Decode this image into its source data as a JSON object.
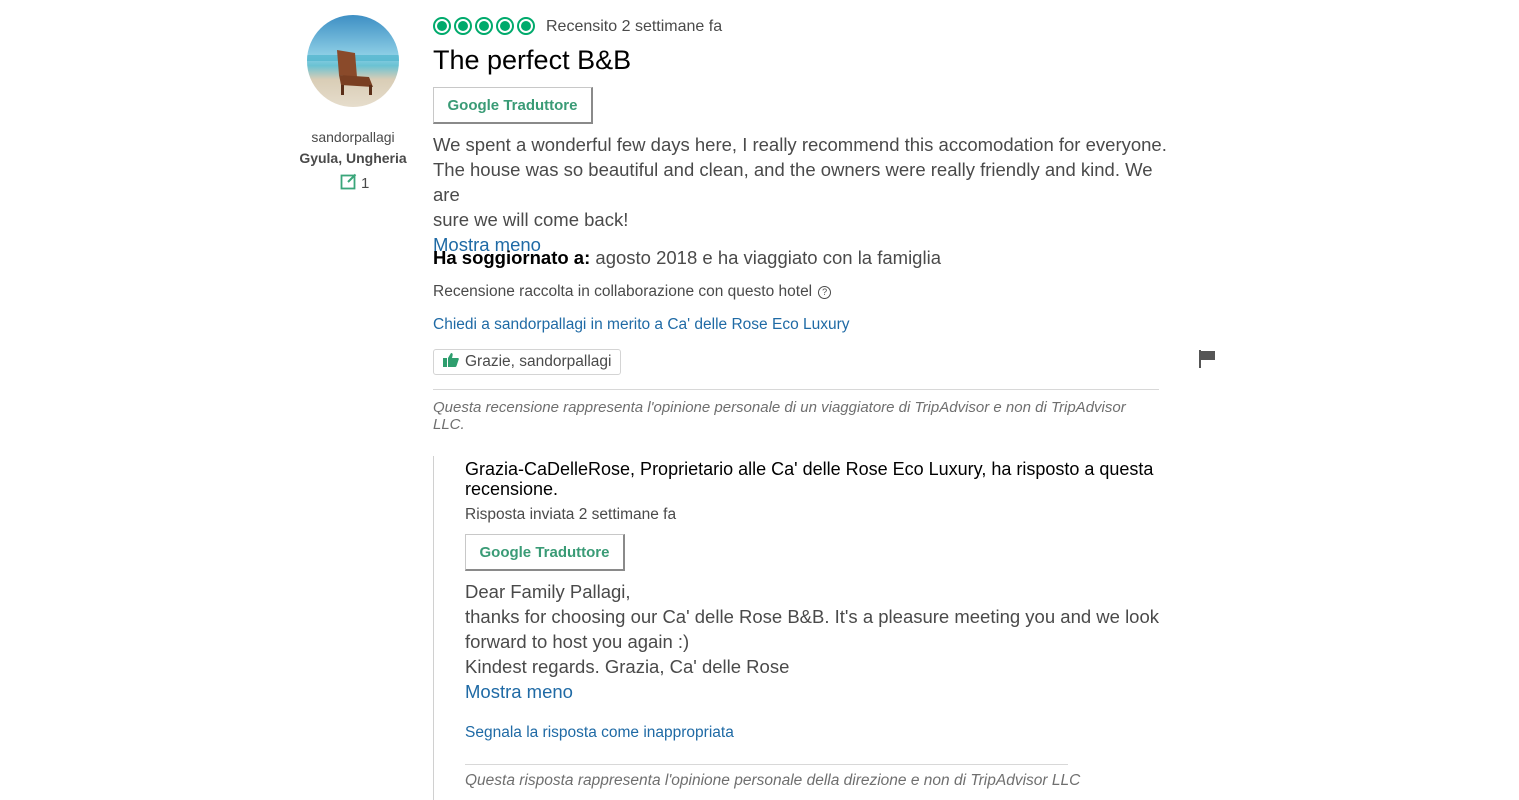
{
  "member": {
    "username": "sandorpallagi",
    "location": "Gyula, Ungheria",
    "contributions": "1"
  },
  "review": {
    "rating": 5,
    "rating_max": 5,
    "date": "Recensito 2 settimane fa",
    "title": "The perfect B&B",
    "translate_label": "Google Traduttore",
    "text_lines": [
      "We spent a wonderful few days here, I really recommend this accomodation for everyone.",
      "The house was so beautiful and clean, and the owners were really friendly and kind. We are",
      "sure we will come back!"
    ],
    "show_less": "Mostra meno",
    "stayed_label": "Ha soggiornato a:",
    "stayed_value": "agosto 2018 e ha viaggiato con la famiglia",
    "collected_note": "Recensione raccolta in collaborazione con questo hotel",
    "ask_link": "Chiedi a sandorpallagi in merito a Ca' delle Rose Eco Luxury",
    "thanks_button": "Grazie, sandorpallagi",
    "disclaimer": "Questa recensione rappresenta l'opinione personale di un viaggiatore di TripAdvisor e non di TripAdvisor LLC."
  },
  "response": {
    "header": "Grazia-CaDelleRose, Proprietario alle Ca' delle Rose Eco Luxury, ha risposto a questa recensione.",
    "date": "Risposta inviata 2 settimane fa",
    "translate_label": "Google Traduttore",
    "text_lines": [
      "Dear Family Pallagi,",
      "thanks for choosing our Ca' delle Rose B&B. It's a pleasure meeting you and we look",
      "forward to host you again :)",
      "Kindest regards. Grazia, Ca' delle Rose"
    ],
    "show_less": "Mostra meno",
    "report_link": "Segnala la risposta come inappropriata",
    "disclaimer": "Questa risposta rappresenta l'opinione personale della direzione e non di TripAdvisor LLC"
  },
  "colors": {
    "bubble_green": "#00aa6c",
    "link_blue": "#1f6aa5",
    "translate_green": "#3a9b76"
  },
  "icons": [
    "edit-contribution-icon",
    "help-circle-icon",
    "thumbs-up-icon",
    "flag-icon"
  ]
}
